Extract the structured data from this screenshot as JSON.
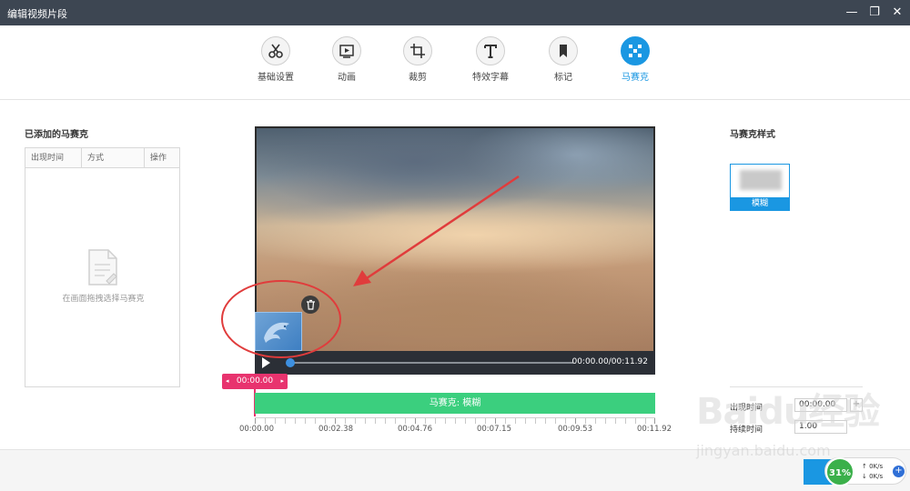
{
  "window": {
    "title": "编辑视频片段",
    "minimize": "—",
    "maximize": "❐",
    "close": "✕"
  },
  "toolbar": {
    "tools": [
      {
        "label": "基础设置",
        "icon": "scissors-icon"
      },
      {
        "label": "动画",
        "icon": "play-frame-icon"
      },
      {
        "label": "裁剪",
        "icon": "crop-icon"
      },
      {
        "label": "特效字幕",
        "icon": "text-t-icon"
      },
      {
        "label": "标记",
        "icon": "bookmark-icon"
      },
      {
        "label": "马赛克",
        "icon": "mosaic-icon",
        "active": true
      }
    ]
  },
  "left_panel": {
    "title": "已添加的马赛克",
    "columns": [
      "出现时间",
      "方式",
      "操作"
    ],
    "empty_text": "在画面拖拽选择马赛克"
  },
  "preview": {
    "timecode": "00:00.00/00:11.92",
    "progress_fraction": 0.0
  },
  "timeline": {
    "marker_time": "00:00.00",
    "marker_left": "◂",
    "marker_right": "▸",
    "track_label": "马赛克: 模糊",
    "ruler_labels": [
      "00:00.00",
      "00:02.38",
      "00:04.76",
      "00:07.15",
      "00:09.53",
      "00:11.92"
    ]
  },
  "right_panel": {
    "title": "马赛克样式",
    "style_option": "模糊",
    "start_label": "出现时间",
    "start_value": "00:00.00",
    "duration_label": "持续时间",
    "duration_value": "1.00",
    "plus": "+"
  },
  "footer": {
    "net_percent": "31%",
    "up_speed": "↑  0K/s",
    "down_speed": "↓  0K/s",
    "net_plus": "+"
  },
  "watermark": {
    "text": "Baidu经验",
    "url": "jingyan.baidu.com"
  },
  "colors": {
    "accent": "#1a97e2",
    "track": "#3bcf7e",
    "marker": "#e8336e",
    "titlebar": "#3d4652",
    "annotation": "#e03c3c"
  }
}
